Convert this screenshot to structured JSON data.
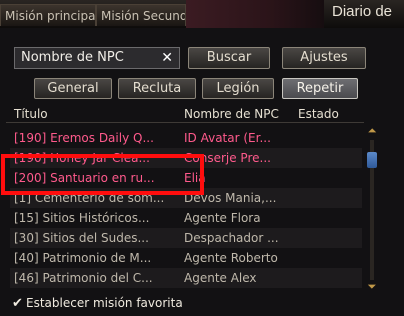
{
  "tabs": {
    "principal": "Misión principal",
    "secundaria": "Misión Secundaria"
  },
  "window": {
    "title": "Diario de"
  },
  "search": {
    "value": "Nombre de NPC",
    "clear_icon": "close-icon"
  },
  "buttons": {
    "buscar": "Buscar",
    "ajustes": "Ajustes"
  },
  "filters": [
    "General",
    "Recluta",
    "Legión",
    "Repetir"
  ],
  "table": {
    "headers": {
      "titulo": "Título",
      "npc": "Nombre de NPC",
      "estado": "Estado"
    },
    "rows": [
      {
        "title": "[190] Eremos Daily Q...",
        "npc": "ID Avatar (Er...",
        "color": "#ff5a8c"
      },
      {
        "title": "[190] Honey Jar Clea...",
        "npc": "Conserje Pre...",
        "color": "#ff5a8c"
      },
      {
        "title": "[200] Santuario en ru...",
        "npc": "Elia",
        "color": "#ff5a8c"
      },
      {
        "title": "[1] Cementerio de som...",
        "npc": "Devos Mania,...",
        "color": "#bfb8ab"
      },
      {
        "title": "[15] Sitios Históricos...",
        "npc": "Agente Flora",
        "color": "#bfb8ab"
      },
      {
        "title": "[30] Sitios del Sudes...",
        "npc": "Despachador ...",
        "color": "#bfb8ab"
      },
      {
        "title": "[40] Patrimonio de M...",
        "npc": "Agente Roberto",
        "color": "#bfb8ab"
      },
      {
        "title": "[46] Patrimonio del C...",
        "npc": "Agente Alex",
        "color": "#bfb8ab"
      }
    ]
  },
  "favorite": {
    "label": "Establecer misión favorita",
    "checked": true
  },
  "colors": {
    "highlight_box": "#ff0d0d",
    "quest_pink": "#ff5a8c",
    "quest_gray": "#bfb8ab"
  }
}
